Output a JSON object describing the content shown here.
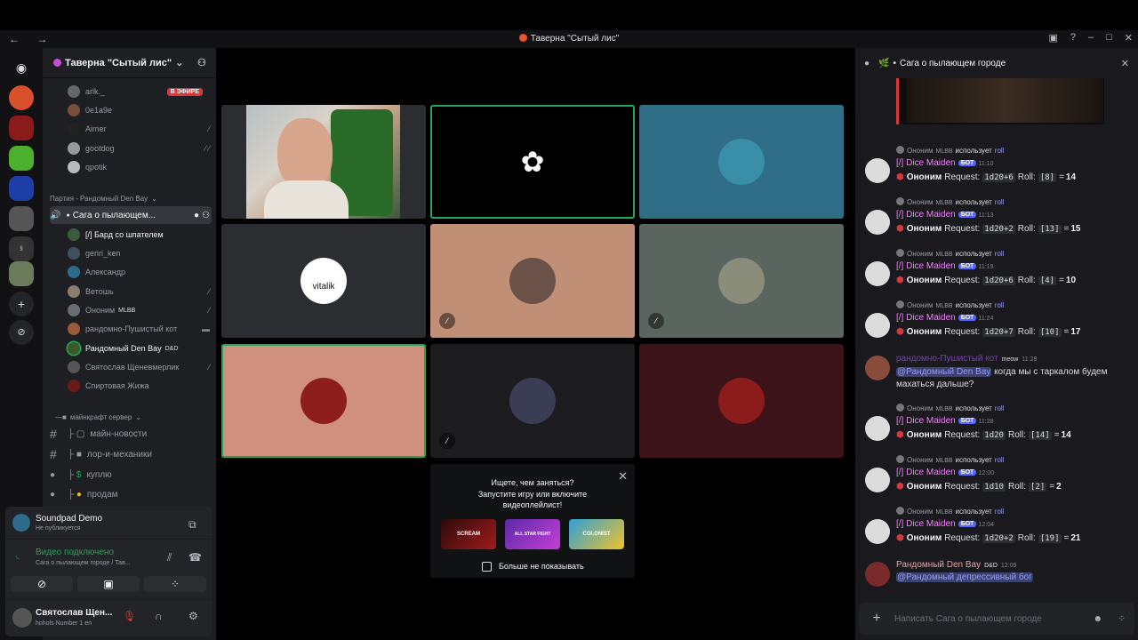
{
  "window": {
    "title": "Таверна \"Сытый лис\""
  },
  "server": {
    "name": "Таверна \"Сытый лис\""
  },
  "voice_top": [
    {
      "name": "arlk._",
      "badge": "В ЭФИРЕ"
    },
    {
      "name": "0e1a9e"
    },
    {
      "name": "Aimer"
    },
    {
      "name": "gootdog"
    },
    {
      "name": "qpotik"
    }
  ],
  "party": {
    "header": "Партия - Рандомный Den Bay",
    "channel": "Сага о пылающем..."
  },
  "party_members": [
    {
      "name": "[/] Бард со шпателем",
      "tag": ""
    },
    {
      "name": "genri_ken",
      "tag": ""
    },
    {
      "name": "Александр",
      "tag": ""
    },
    {
      "name": "Ветошь",
      "tag": ""
    },
    {
      "name": "Ононим",
      "tag": "MLBB"
    },
    {
      "name": "рандомно-Пушистый кот",
      "tag": ""
    },
    {
      "name": "Рандомный Den Bay",
      "tag": "D&D"
    },
    {
      "name": "Святослав Щеневмерлик",
      "tag": ""
    },
    {
      "name": "Спиртовая Жижа",
      "tag": ""
    }
  ],
  "category": {
    "name": "майнкрафт сервер"
  },
  "text_channels": [
    "майн-новости",
    "лор-и-механики",
    "куплю",
    "продам"
  ],
  "soundpad": {
    "title": "Soundpad Demo",
    "status": "Не публикуется"
  },
  "voice_status": {
    "title": "Видео подключено",
    "channel": "Сага о пылающем городе / Тав..."
  },
  "user": {
    "name": "Святослав Щен...",
    "status": "hohols Number 1 en"
  },
  "tiles": [
    {
      "label": "vitalik"
    }
  ],
  "popup": {
    "title": "Ищете, чем заняться?",
    "body": "Запустите игру или включите видеоплейлист!",
    "checkbox": "Больше не показывать",
    "games": [
      "SCREAM",
      "ALL STAR FIGHT",
      "COLONIST"
    ]
  },
  "chat": {
    "title": "Сага о пылающем городе",
    "input_placeholder": "Написать  Сага о пылающем городе",
    "bot_label": "БОТ",
    "uses": "использует",
    "cmd": "roll",
    "user_tag": "MLBB",
    "rolls": [
      {
        "user": "Ононим",
        "bot": "[/] Dice Maiden",
        "time": "11:10",
        "request": "1d20+6",
        "roll": "[8]",
        "total": "14"
      },
      {
        "user": "Ононим",
        "bot": "[/] Dice Maiden",
        "time": "11:13",
        "request": "1d20+2",
        "roll": "[13]",
        "total": "15"
      },
      {
        "user": "Ононим",
        "bot": "[/] Dice Maiden",
        "time": "11:19",
        "request": "1d20+6",
        "roll": "[4]",
        "total": "10"
      },
      {
        "user": "Ононим",
        "bot": "[/] Dice Maiden",
        "time": "11:24",
        "request": "1d20+7",
        "roll": "[10]",
        "total": "17"
      }
    ],
    "cat_msg": {
      "author": "рандомно-Пушистый кот",
      "tag": "meow",
      "time": "11:28",
      "mention": "@Рандомный Den Bay",
      "text": "когда мы с таркалом будем махаться дальше?"
    },
    "rolls2": [
      {
        "user": "Ононим",
        "bot": "[/] Dice Maiden",
        "time": "11:28",
        "request": "1d20",
        "roll": "[14]",
        "total": "14"
      },
      {
        "user": "Ононим",
        "bot": "[/] Dice Maiden",
        "time": "12:00",
        "request": "1d10",
        "roll": "[2]",
        "total": "2"
      },
      {
        "user": "Ононим",
        "bot": "[/] Dice Maiden",
        "time": "12:04",
        "request": "1d20+2",
        "roll": "[19]",
        "total": "21"
      }
    ],
    "last_msg": {
      "author": "Рандомный Den Bay",
      "tag": "D&D",
      "time": "12:09",
      "mention": "@Рандомный депрессивный бог"
    },
    "request_label": "Request:",
    "roll_label": "Roll:"
  }
}
